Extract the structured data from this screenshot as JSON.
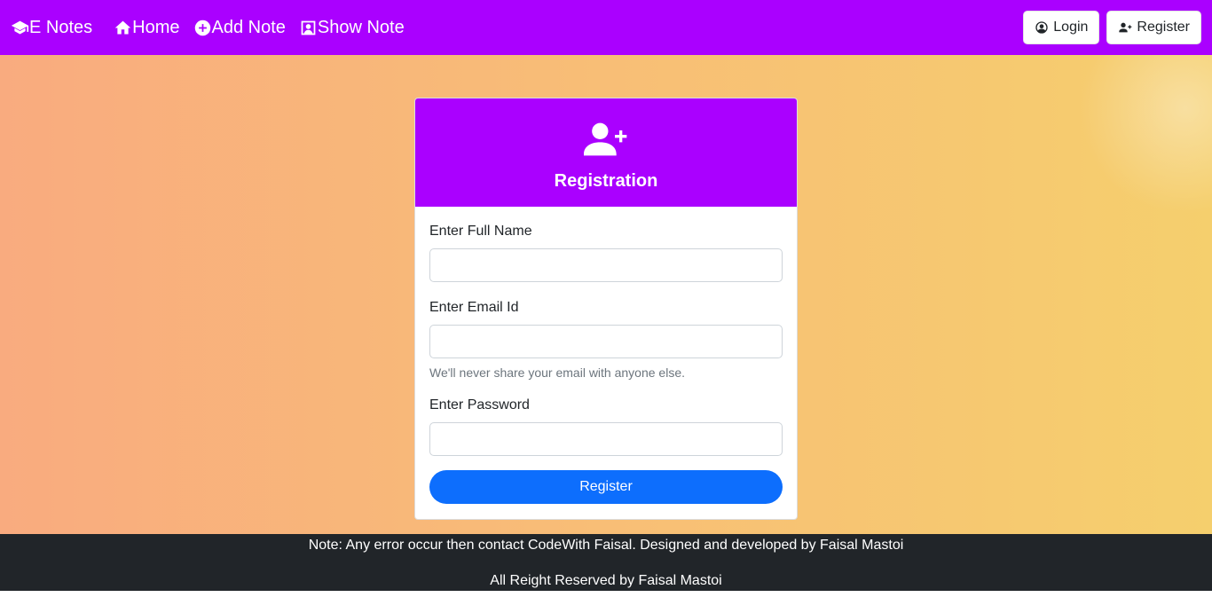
{
  "navbar": {
    "brand": "E Notes",
    "links": [
      {
        "label": "Home",
        "icon": "home-icon"
      },
      {
        "label": "Add Note",
        "icon": "plus-circle-icon"
      },
      {
        "label": "Show Note",
        "icon": "user-square-icon"
      }
    ],
    "login_label": "Login",
    "register_label": "Register",
    "background_color": "#aa00ff"
  },
  "form": {
    "title": "Registration",
    "header_icon": "user-plus-icon",
    "fullname_label": "Enter Full Name",
    "fullname_value": "",
    "email_label": "Enter Email Id",
    "email_value": "",
    "email_help": "We'll never share your email with anyone else.",
    "password_label": "Enter Password",
    "password_value": "",
    "submit_label": "Register",
    "submit_color": "#0d6efd"
  },
  "footer": {
    "note": "Note: Any error occur then contact CodeWith Faisal. Designed and developed by Faisal Mastoi",
    "copyright": "All Reight Reserved by Faisal Mastoi"
  }
}
